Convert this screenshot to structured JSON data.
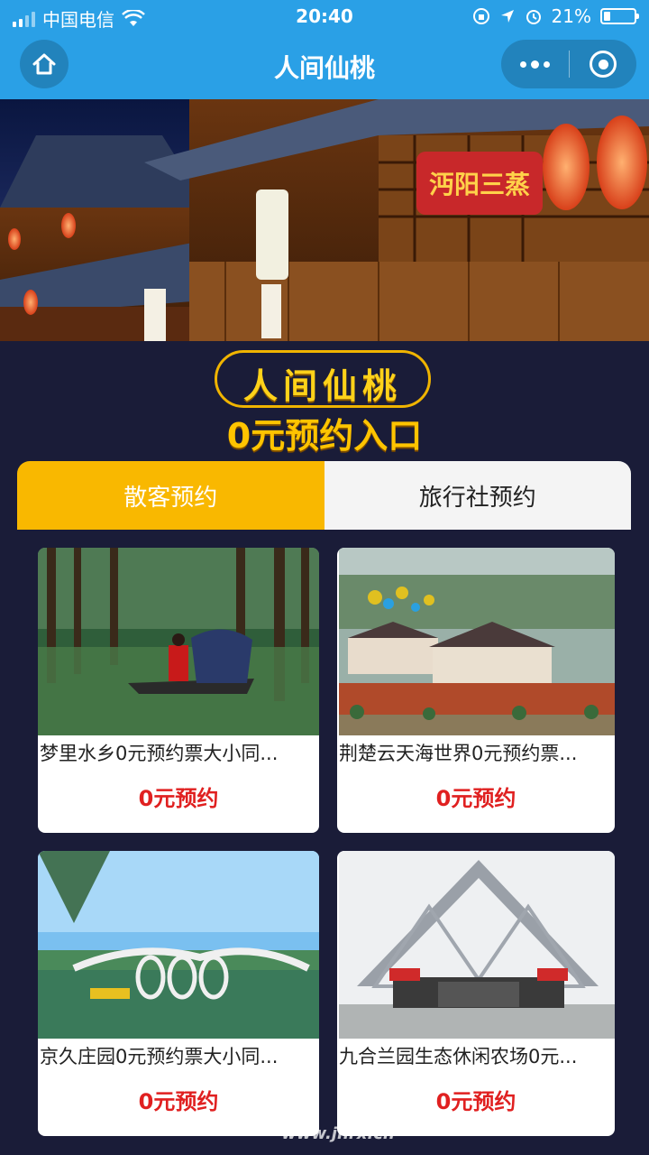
{
  "status_bar": {
    "carrier": "中国电信",
    "time": "20:40",
    "battery": "21%"
  },
  "nav": {
    "title": "人间仙桃"
  },
  "logo": {
    "line1": "人间仙桃",
    "line2": "0元预约入口"
  },
  "banner": {
    "sign_text": "沔阳三蒸"
  },
  "tabs": [
    {
      "label": "散客预约",
      "active": true
    },
    {
      "label": "旅行社预约",
      "active": false
    }
  ],
  "cards": [
    {
      "name": "梦里水乡0元预约票大小同...",
      "cta": "0元预约"
    },
    {
      "name": "荆楚云天海世界0元预约票...",
      "cta": "0元预约"
    },
    {
      "name": "京久庄园0元预约票大小同...",
      "cta": "0元预约"
    },
    {
      "name": "九合兰园生态休闲农场0元...",
      "cta": "0元预约"
    }
  ],
  "watermark": "www.jhrx.cn",
  "colors": {
    "nav_bg": "#2aa0e6",
    "page_bg": "#1a1c38",
    "tab_active": "#f9b800",
    "cta_red": "#e02020",
    "logo_gold": "#ffc400"
  }
}
